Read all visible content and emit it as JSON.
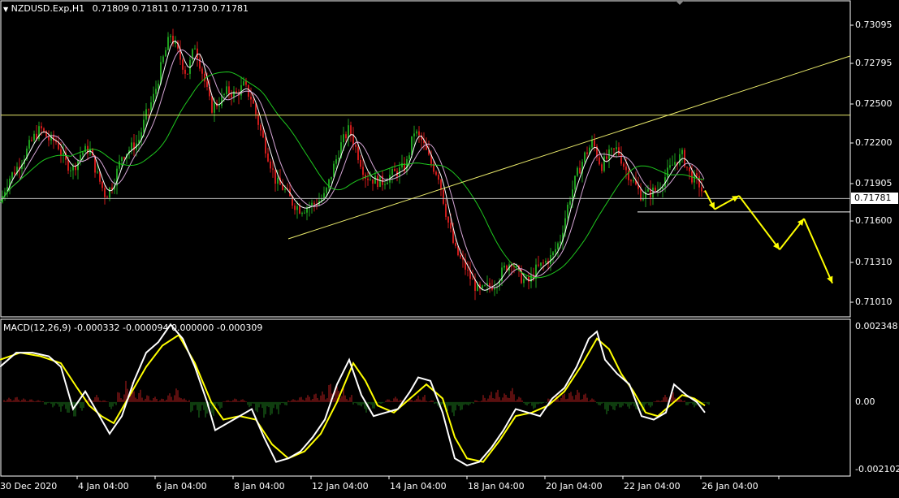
{
  "header": {
    "symbol": "NZDUSD.Exp,H1",
    "ohlc": "0.71809 0.71811 0.71730 0.71781"
  },
  "macd_header": "MACD(12,26,9) -0.000332 -0.000094 0.000000 -0.000309",
  "price_axis": [
    "0.73095",
    "0.72795",
    "0.72500",
    "0.72200",
    "0.71905",
    "0.71781",
    "0.71600",
    "0.71310",
    "0.71010"
  ],
  "current_price": "0.71781",
  "macd_axis": [
    "0.002348",
    "0.00",
    "-0.002102"
  ],
  "time_axis": [
    "30 Dec 2020",
    "4 Jan 04:00",
    "6 Jan 04:00",
    "8 Jan 04:00",
    "12 Jan 04:00",
    "14 Jan 04:00",
    "18 Jan 04:00",
    "20 Jan 04:00",
    "22 Jan 04:00",
    "26 Jan 04:00"
  ],
  "colors": {
    "background": "#000000",
    "bull": "#1e9e1e",
    "bear": "#cc1a1a",
    "ma_fast": "#ffffff",
    "ma_mid": "#d7a7d7",
    "ma_slow": "#1ec81e",
    "trend": "#e8e86a",
    "arrow": "#ffff00",
    "macd_line": "#ffffff",
    "signal_line": "#ffff00",
    "hist_pos": "#b41e1e",
    "hist_neg": "#1e7a1e"
  },
  "chart_data": [
    {
      "type": "candlestick",
      "title": "NZDUSD.Exp,H1",
      "ylim": [
        0.709,
        0.7325
      ],
      "x_ticks": [
        "30 Dec 2020",
        "4 Jan 04:00",
        "6 Jan 04:00",
        "8 Jan 04:00",
        "12 Jan 04:00",
        "14 Jan 04:00",
        "18 Jan 04:00",
        "20 Jan 04:00",
        "22 Jan 04:00",
        "26 Jan 04:00"
      ],
      "close_path": [
        [
          0,
          0.7175
        ],
        [
          10,
          0.7192
        ],
        [
          20,
          0.72
        ],
        [
          30,
          0.721
        ],
        [
          40,
          0.7222
        ],
        [
          50,
          0.723
        ],
        [
          60,
          0.7222
        ],
        [
          70,
          0.722
        ],
        [
          80,
          0.7205
        ],
        [
          90,
          0.72
        ],
        [
          100,
          0.7212
        ],
        [
          110,
          0.7215
        ],
        [
          120,
          0.7195
        ],
        [
          130,
          0.718
        ],
        [
          140,
          0.719
        ],
        [
          150,
          0.721
        ],
        [
          160,
          0.7215
        ],
        [
          170,
          0.722
        ],
        [
          180,
          0.724
        ],
        [
          190,
          0.7255
        ],
        [
          200,
          0.728
        ],
        [
          210,
          0.73
        ],
        [
          220,
          0.7285
        ],
        [
          230,
          0.727
        ],
        [
          240,
          0.7292
        ],
        [
          250,
          0.727
        ],
        [
          260,
          0.7245
        ],
        [
          270,
          0.725
        ],
        [
          280,
          0.7258
        ],
        [
          290,
          0.7255
        ],
        [
          300,
          0.7262
        ],
        [
          310,
          0.7252
        ],
        [
          320,
          0.723
        ],
        [
          330,
          0.721
        ],
        [
          340,
          0.719
        ],
        [
          350,
          0.7185
        ],
        [
          360,
          0.7175
        ],
        [
          370,
          0.717
        ],
        [
          380,
          0.7172
        ],
        [
          390,
          0.7175
        ],
        [
          400,
          0.718
        ],
        [
          410,
          0.72
        ],
        [
          420,
          0.7218
        ],
        [
          430,
          0.723
        ],
        [
          440,
          0.7212
        ],
        [
          450,
          0.7195
        ],
        [
          460,
          0.7192
        ],
        [
          470,
          0.719
        ],
        [
          480,
          0.7195
        ],
        [
          490,
          0.7198
        ],
        [
          500,
          0.7202
        ],
        [
          510,
          0.7228
        ],
        [
          520,
          0.722
        ],
        [
          530,
          0.7205
        ],
        [
          540,
          0.7195
        ],
        [
          550,
          0.7165
        ],
        [
          560,
          0.714
        ],
        [
          570,
          0.713
        ],
        [
          580,
          0.7118
        ],
        [
          590,
          0.7108
        ],
        [
          600,
          0.7112
        ],
        [
          610,
          0.7115
        ],
        [
          620,
          0.7125
        ],
        [
          630,
          0.7132
        ],
        [
          640,
          0.712
        ],
        [
          650,
          0.7115
        ],
        [
          660,
          0.7125
        ],
        [
          670,
          0.713
        ],
        [
          680,
          0.7135
        ],
        [
          690,
          0.7148
        ],
        [
          700,
          0.7175
        ],
        [
          710,
          0.7195
        ],
        [
          720,
          0.721
        ],
        [
          730,
          0.722
        ],
        [
          740,
          0.7202
        ],
        [
          750,
          0.721
        ],
        [
          760,
          0.7215
        ],
        [
          770,
          0.72
        ],
        [
          780,
          0.719
        ],
        [
          790,
          0.718
        ],
        [
          800,
          0.7182
        ],
        [
          810,
          0.7185
        ],
        [
          820,
          0.7195
        ],
        [
          830,
          0.7205
        ],
        [
          840,
          0.721
        ],
        [
          850,
          0.7195
        ],
        [
          860,
          0.719
        ],
        [
          868,
          0.7178
        ]
      ],
      "horizontal_levels": [
        0.724,
        0.7178,
        0.7168
      ],
      "trendline": [
        [
          355,
          0.7148
        ],
        [
          1047,
          0.7284
        ]
      ]
    },
    {
      "type": "macd",
      "title": "MACD(12,26,9)",
      "ylim": [
        -0.002102,
        0.002348
      ],
      "macd": [
        [
          0,
          0.001
        ],
        [
          20,
          0.0014
        ],
        [
          40,
          0.0014
        ],
        [
          60,
          0.0013
        ],
        [
          75,
          0.001
        ],
        [
          90,
          -0.0002
        ],
        [
          105,
          0.0003
        ],
        [
          120,
          -0.0003
        ],
        [
          135,
          -0.0009
        ],
        [
          150,
          -0.0004
        ],
        [
          165,
          0.0006
        ],
        [
          180,
          0.0014
        ],
        [
          195,
          0.0017
        ],
        [
          210,
          0.0022
        ],
        [
          225,
          0.0018
        ],
        [
          240,
          0.001
        ],
        [
          255,
          0.0
        ],
        [
          265,
          -0.0008
        ],
        [
          280,
          -0.0006
        ],
        [
          295,
          -0.0004
        ],
        [
          310,
          -0.0002
        ],
        [
          325,
          -0.001
        ],
        [
          340,
          -0.0017
        ],
        [
          355,
          -0.0016
        ],
        [
          370,
          -0.0014
        ],
        [
          385,
          -0.001
        ],
        [
          400,
          -0.0005
        ],
        [
          415,
          0.0005
        ],
        [
          430,
          0.0012
        ],
        [
          445,
          0.0002
        ],
        [
          460,
          -0.0004
        ],
        [
          475,
          -0.0003
        ],
        [
          490,
          -0.0002
        ],
        [
          505,
          0.0003
        ],
        [
          515,
          0.0007
        ],
        [
          530,
          0.0006
        ],
        [
          545,
          -0.0003
        ],
        [
          560,
          -0.0016
        ],
        [
          575,
          -0.0018
        ],
        [
          590,
          -0.0017
        ],
        [
          605,
          -0.0013
        ],
        [
          620,
          -0.0008
        ],
        [
          635,
          -0.0002
        ],
        [
          650,
          -0.0003
        ],
        [
          665,
          -0.0004
        ],
        [
          680,
          0.0001
        ],
        [
          695,
          0.0004
        ],
        [
          710,
          0.001
        ],
        [
          725,
          0.0018
        ],
        [
          735,
          0.002
        ],
        [
          745,
          0.0012
        ],
        [
          760,
          0.0008
        ],
        [
          775,
          0.0005
        ],
        [
          790,
          -0.0004
        ],
        [
          805,
          -0.0005
        ],
        [
          820,
          -0.0003
        ],
        [
          830,
          0.0005
        ],
        [
          845,
          0.0002
        ],
        [
          858,
          0.0
        ],
        [
          868,
          -0.0003
        ]
      ],
      "signal": [
        [
          0,
          0.0012
        ],
        [
          25,
          0.0014
        ],
        [
          50,
          0.0013
        ],
        [
          75,
          0.0011
        ],
        [
          95,
          0.0004
        ],
        [
          110,
          -0.0001
        ],
        [
          125,
          -0.0004
        ],
        [
          140,
          -0.0006
        ],
        [
          160,
          0.0002
        ],
        [
          180,
          0.001
        ],
        [
          200,
          0.0016
        ],
        [
          220,
          0.0019
        ],
        [
          240,
          0.0011
        ],
        [
          260,
          0.0
        ],
        [
          275,
          -0.0005
        ],
        [
          295,
          -0.0004
        ],
        [
          315,
          -0.0005
        ],
        [
          335,
          -0.0012
        ],
        [
          355,
          -0.0016
        ],
        [
          375,
          -0.0014
        ],
        [
          395,
          -0.0009
        ],
        [
          415,
          0.0
        ],
        [
          435,
          0.0011
        ],
        [
          450,
          0.0006
        ],
        [
          465,
          -0.0001
        ],
        [
          485,
          -0.0003
        ],
        [
          505,
          0.0001
        ],
        [
          525,
          0.0005
        ],
        [
          545,
          0.0001
        ],
        [
          560,
          -0.001
        ],
        [
          575,
          -0.0016
        ],
        [
          595,
          -0.0017
        ],
        [
          615,
          -0.0011
        ],
        [
          635,
          -0.0004
        ],
        [
          655,
          -0.0003
        ],
        [
          675,
          -0.0001
        ],
        [
          695,
          0.0003
        ],
        [
          715,
          0.001
        ],
        [
          735,
          0.0018
        ],
        [
          750,
          0.0015
        ],
        [
          765,
          0.0008
        ],
        [
          780,
          0.0003
        ],
        [
          795,
          -0.0003
        ],
        [
          810,
          -0.0004
        ],
        [
          825,
          -0.0001
        ],
        [
          840,
          0.0002
        ],
        [
          855,
          0.0001
        ],
        [
          868,
          -0.0001
        ]
      ],
      "histogram": [
        [
          5,
          0.00012
        ],
        [
          15,
          0.00015
        ],
        [
          25,
          0.0001
        ],
        [
          35,
          8e-05
        ],
        [
          45,
          5e-05
        ],
        [
          55,
          -8e-05
        ],
        [
          65,
          -0.00015
        ],
        [
          75,
          -0.0003
        ],
        [
          85,
          -0.00045
        ],
        [
          95,
          -0.00025
        ],
        [
          105,
          0.0001
        ],
        [
          115,
          0.0002
        ],
        [
          125,
          5e-05
        ],
        [
          135,
          -0.0002
        ],
        [
          145,
          0.0003
        ],
        [
          155,
          0.0006
        ],
        [
          165,
          0.00035
        ],
        [
          175,
          0.0002
        ],
        [
          185,
          0.00015
        ],
        [
          195,
          0.0001
        ],
        [
          205,
          0.00025
        ],
        [
          215,
          0.0004
        ],
        [
          225,
          0.0001
        ],
        [
          235,
          -0.0003
        ],
        [
          245,
          -0.00045
        ],
        [
          255,
          -0.0004
        ],
        [
          265,
          -0.0002
        ],
        [
          275,
          5e-05
        ],
        [
          285,
          0.0001
        ],
        [
          295,
          8e-05
        ],
        [
          305,
          -0.00015
        ],
        [
          315,
          -0.0003
        ],
        [
          325,
          -0.00045
        ],
        [
          335,
          -0.00035
        ],
        [
          345,
          -0.0001
        ],
        [
          355,
          8e-05
        ],
        [
          365,
          0.00015
        ],
        [
          375,
          0.0002
        ],
        [
          385,
          0.00025
        ],
        [
          395,
          0.0003
        ],
        [
          405,
          0.00055
        ],
        [
          415,
          0.00045
        ],
        [
          425,
          0.0002
        ],
        [
          435,
          -0.0001
        ],
        [
          445,
          -0.0003
        ],
        [
          455,
          -0.0002
        ],
        [
          465,
          -5e-05
        ],
        [
          475,
          8e-05
        ],
        [
          485,
          0.00015
        ],
        [
          495,
          5e-05
        ],
        [
          505,
          0.0001
        ],
        [
          515,
          0.0002
        ],
        [
          525,
          5e-05
        ],
        [
          535,
          -0.00015
        ],
        [
          545,
          -0.0003
        ],
        [
          555,
          -0.0004
        ],
        [
          565,
          -0.00025
        ],
        [
          575,
          -0.0001
        ],
        [
          585,
          5e-05
        ],
        [
          595,
          0.0002
        ],
        [
          605,
          0.00035
        ],
        [
          615,
          0.00025
        ],
        [
          625,
          0.0004
        ],
        [
          635,
          0.00015
        ],
        [
          645,
          -0.0001
        ],
        [
          655,
          -0.0002
        ],
        [
          665,
          -5e-05
        ],
        [
          675,
          0.0001
        ],
        [
          685,
          0.0002
        ],
        [
          695,
          0.0003
        ],
        [
          705,
          0.00035
        ],
        [
          715,
          0.00025
        ],
        [
          725,
          0.0001
        ],
        [
          735,
          -0.0001
        ],
        [
          745,
          -0.00035
        ],
        [
          755,
          -0.00025
        ],
        [
          765,
          -0.00015
        ],
        [
          775,
          -0.0002
        ],
        [
          785,
          -0.0003
        ],
        [
          795,
          -0.00015
        ],
        [
          805,
          5e-05
        ],
        [
          815,
          0.0002
        ],
        [
          825,
          0.0003
        ],
        [
          835,
          0.0001
        ],
        [
          845,
          -0.0001
        ],
        [
          855,
          -0.00015
        ],
        [
          865,
          -8e-05
        ]
      ]
    }
  ],
  "forecast_arrow_points": [
    [
      868,
      0.7184
    ],
    [
      880,
      0.717
    ],
    [
      910,
      0.718
    ],
    [
      960,
      0.714
    ],
    [
      990,
      0.7163
    ],
    [
      1025,
      0.7115
    ]
  ]
}
